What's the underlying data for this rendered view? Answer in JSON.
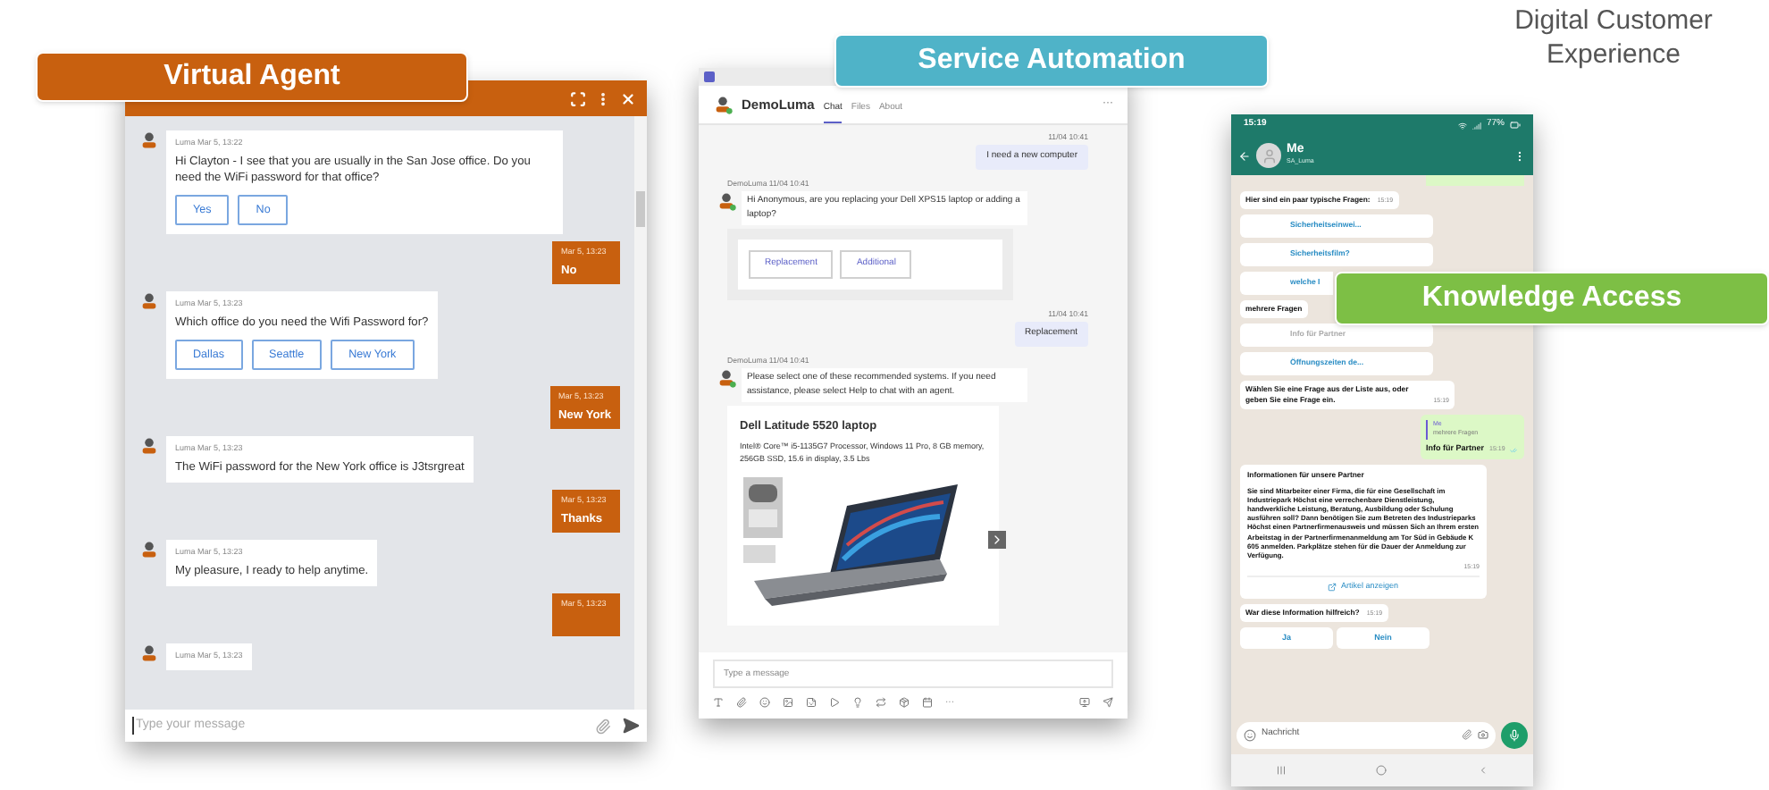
{
  "heading": "Digital Customer Experience",
  "virtual_agent": {
    "label": "Virtual Agent",
    "messages": [
      {
        "kind": "bot",
        "sender": "Luma",
        "time": "Mar 5, 13:22",
        "text": "Hi Clayton - I see that you are usually in the San Jose office. Do you need the WiFi password for that office?",
        "buttons": [
          "Yes",
          "No"
        ]
      },
      {
        "kind": "user",
        "time": "Mar 5, 13:23",
        "text": "No"
      },
      {
        "kind": "bot",
        "sender": "Luma",
        "time": "Mar 5, 13:23",
        "text": "Which office do you need the Wifi Password for?",
        "buttons": [
          "Dallas",
          "Seattle",
          "New York"
        ]
      },
      {
        "kind": "user",
        "time": "Mar 5, 13:23",
        "text": "New York"
      },
      {
        "kind": "bot",
        "sender": "Luma",
        "time": "Mar 5, 13:23",
        "text": "The WiFi password for the New York office is J3tsrgreat"
      },
      {
        "kind": "user",
        "time": "Mar 5, 13:23",
        "text": "Thanks"
      },
      {
        "kind": "bot",
        "sender": "Luma",
        "time": "Mar 5, 13:23",
        "text": "My pleasure, I ready to help anytime."
      },
      {
        "kind": "user",
        "time": "Mar 5, 13:23"
      },
      {
        "kind": "bot",
        "sender": "Luma",
        "time": "Mar 5, 13:23"
      }
    ],
    "input": {
      "placeholder": "Type your message"
    }
  },
  "service_automation": {
    "label": "Service Automation",
    "title": "DemoLuma",
    "tabs": [
      {
        "label": "Chat",
        "selected": true
      },
      {
        "label": "Files",
        "selected": false
      },
      {
        "label": "About",
        "selected": false
      }
    ],
    "more": "···",
    "messages": [
      {
        "kind": "user",
        "time": "11/04 10:41",
        "text": "I need a new computer"
      },
      {
        "kind": "bot",
        "sender": "DemoLuma",
        "time": "11/04 10:41",
        "text": "Hi Anonymous, are you replacing your Dell XPS15 laptop or adding a laptop?",
        "buttons": [
          "Replacement",
          "Additional"
        ]
      },
      {
        "kind": "user",
        "time": "11/04 10:41",
        "text": "Replacement"
      },
      {
        "kind": "bot",
        "sender": "DemoLuma",
        "time": "11/04 10:41",
        "text": "Please select one of these recommended systems. If you need assistance, please select Help to chat with an agent.",
        "card": {
          "title": "Dell Latitude 5520 laptop",
          "description": "Intel® Core™ i5-1135G7 Processor, Windows 11 Pro, 8 GB memory, 256GB SSD, 15.6 in display, 3.5 Lbs"
        }
      }
    ],
    "input": {
      "placeholder": "Type a message"
    },
    "toolbar_more": "···"
  },
  "knowledge_access": {
    "label": "Knowledge Access",
    "status_bar": {
      "time": "15:19",
      "battery": "77%"
    },
    "contact": {
      "name": "Me",
      "subtitle": "SA_Luma"
    },
    "messages": [
      {
        "kind": "bot",
        "text": "Hier sind ein paar typische Fragen:",
        "time": "15:19"
      },
      {
        "kind": "option",
        "text": "Sicherheitseinwei...",
        "disabled": false
      },
      {
        "kind": "option",
        "text": "Sicherheitsfilm?",
        "disabled": false
      },
      {
        "kind": "cut_option",
        "text": "welche I",
        "disabled": false
      },
      {
        "kind": "bot",
        "text": "mehrere Fragen"
      },
      {
        "kind": "option",
        "text": "Info für Partner",
        "disabled": true
      },
      {
        "kind": "option",
        "text": "Öffnungszeiten de...",
        "disabled": false
      },
      {
        "kind": "bot",
        "text": "Wählen Sie eine Frage aus der Liste aus, oder geben Sie eine Frage ein.",
        "time": "15:19"
      },
      {
        "kind": "user",
        "quote_author": "Me",
        "quote": "mehrere Fragen",
        "text": "Info für Partner",
        "time": "15:19"
      },
      {
        "kind": "article",
        "title": "Informationen für unsere Partner",
        "text": "Sie sind Mitarbeiter einer Firma, die für eine Gesellschaft im Industriepark Höchst eine verrechenbare Dienstleistung, handwerkliche Leistung, Beratung, Ausbildung oder Schulung ausführen soll? Dann benötigen Sie zum Betreten des Industrieparks Höchst einen Partnerfirmenausweis und müssen Sich an Ihrem ersten Arbeitstag in der Partnerfirmenanmeldung am Tor Süd in Gebäude K 605 anmelden. Parkplätze stehen für die Dauer der Anmeldung zur Verfügung.",
        "time": "15:19",
        "link": "Artikel anzeigen"
      },
      {
        "kind": "bot",
        "text": "War diese Information hilfreich?",
        "time": "15:19"
      },
      {
        "kind": "choices",
        "buttons": [
          "Ja",
          "Nein"
        ]
      }
    ],
    "input": {
      "placeholder": "Nachricht"
    }
  }
}
